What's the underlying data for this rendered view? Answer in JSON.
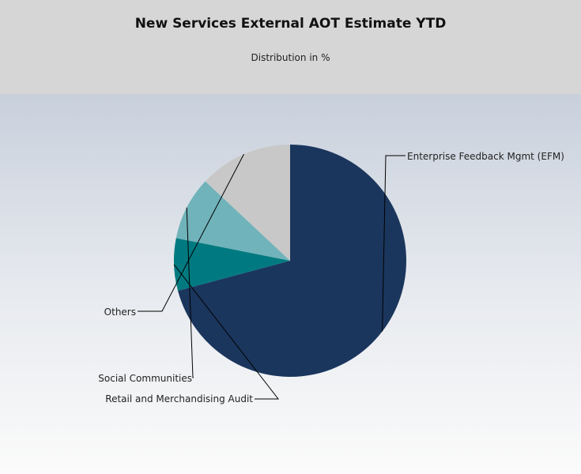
{
  "header": {
    "title": "New Services External AOT Estimate YTD",
    "subtitle": "Distribution in %"
  },
  "chart_data": {
    "type": "pie",
    "title": "New Services External AOT Estimate YTD",
    "subtitle": "Distribution in %",
    "labels": [
      "Enterprise Feedback Mgmt (EFM)",
      "Retail and Merchandising Audit",
      "Social Communities",
      "Others"
    ],
    "values": [
      68,
      7,
      8.5,
      12.5
    ],
    "colors": [
      "#1b365d",
      "#007a80",
      "#70b3ba",
      "#c8c8c8"
    ],
    "start_angle_deg": 270,
    "direction": "clockwise",
    "legend": "none",
    "data_labels": "outside with leader lines"
  }
}
